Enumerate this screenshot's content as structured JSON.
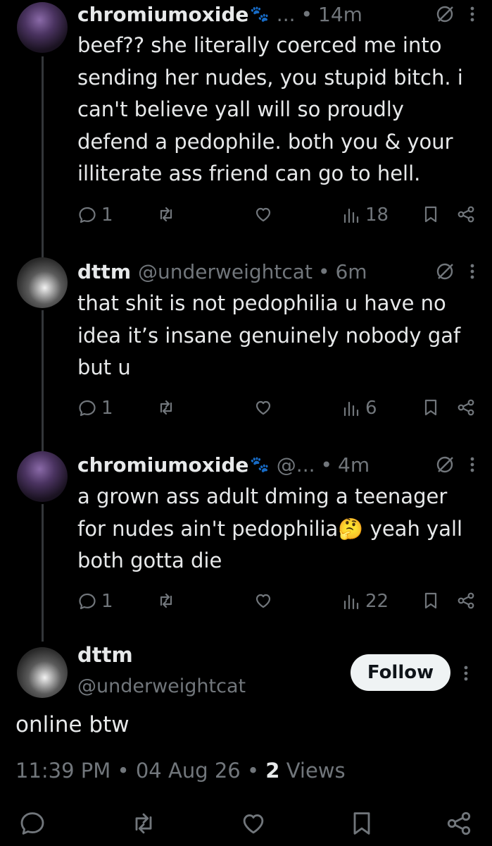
{
  "replies": [
    {
      "name": "chromiumoxide",
      "handle": "...",
      "time": "14m",
      "text": "beef?? she literally coerced me into sending her nudes, you stupid bitch. i can't believe yall will so proudly defend a pedophile. both you & your illiterate ass friend can go to hell.",
      "replies_count": "1",
      "views": "18"
    },
    {
      "name": "dttm",
      "handle": "@underweightcat",
      "time": "6m",
      "text": "that shit is not pedophilia u have no idea it’s insane genuinely nobody gaf but u",
      "replies_count": "1",
      "views": "6"
    },
    {
      "name": "chromiumoxide",
      "handle": "@...",
      "time": "4m",
      "text_before_emoji": "a grown ass adult dming a teenager for nudes ain't pedophilia",
      "emoji": "🤔",
      "text_after_emoji": " yeah yall both gotta die",
      "replies_count": "1",
      "views": "22"
    }
  ],
  "main_tweet": {
    "name": "dttm",
    "handle": "@underweightcat",
    "follow_label": "Follow",
    "text": "online btw",
    "time": "11:39 PM",
    "date": "04 Aug 26",
    "views_count": "2",
    "views_label": "Views"
  },
  "separator": "•",
  "icons": [
    "reply-icon",
    "retweet-icon",
    "like-icon",
    "views-icon",
    "bookmark-icon",
    "share-icon",
    "grok-icon",
    "more-icon",
    "paw-emoji",
    "thinking-emoji"
  ],
  "colors": {
    "background": "#000000",
    "text": "#e7e9ea",
    "muted": "#71767b",
    "thread_line": "#333639"
  }
}
